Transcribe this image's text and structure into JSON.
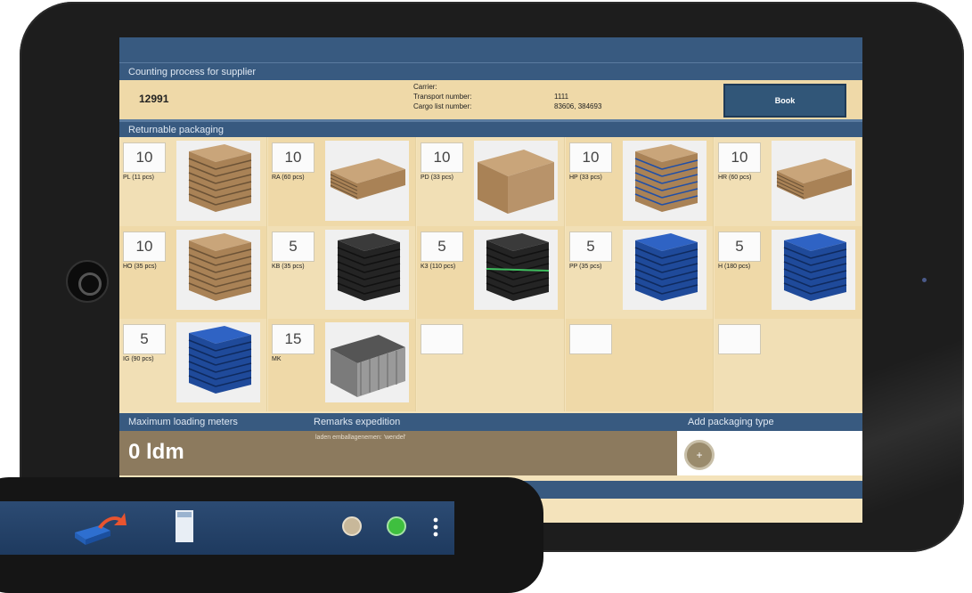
{
  "app": {
    "section_title": "Counting process for supplier",
    "supplier_id": "12991",
    "carrier_label": "Carrier:",
    "transport_label": "Transport number:",
    "cargo_label": "Cargo list number:",
    "transport_value": "1111",
    "cargo_value": "83606, 384693",
    "book_label": "Book",
    "packaging_title": "Returnable packaging"
  },
  "packaging": [
    {
      "count": "10",
      "label": "PL (11 pcs)",
      "kind": "wood"
    },
    {
      "count": "10",
      "label": "RA (60 pcs)",
      "kind": "wood-flat"
    },
    {
      "count": "10",
      "label": "PD (33 pcs)",
      "kind": "wood-box"
    },
    {
      "count": "10",
      "label": "HP (33 pcs)",
      "kind": "wood-blue"
    },
    {
      "count": "10",
      "label": "HR (60 pcs)",
      "kind": "wood-flat"
    },
    {
      "count": "10",
      "label": "HO (35 pcs)",
      "kind": "wood"
    },
    {
      "count": "5",
      "label": "KB (35 pcs)",
      "kind": "dark"
    },
    {
      "count": "5",
      "label": "K3 (110 pcs)",
      "kind": "dark-green"
    },
    {
      "count": "5",
      "label": "PP (35 pcs)",
      "kind": "blue"
    },
    {
      "count": "5",
      "label": "H (180 pcs)",
      "kind": "blue"
    },
    {
      "count": "5",
      "label": "IG (90 pcs)",
      "kind": "blue"
    },
    {
      "count": "15",
      "label": "MK",
      "kind": "metal"
    },
    {
      "count": "",
      "label": "",
      "kind": "none"
    },
    {
      "count": "",
      "label": "",
      "kind": "none"
    },
    {
      "count": "",
      "label": "",
      "kind": "none"
    }
  ],
  "bottom": {
    "max_loading_label": "Maximum loading meters",
    "remarks_label": "Remarks expedition",
    "add_packaging_label": "Add packaging type",
    "ldm_value": "0 ldm",
    "remarks_text": "laden emballagenemen: 'wendel'"
  },
  "colors": {
    "header_blue": "#385a80",
    "panel_beige": "#f4e3bb",
    "ldm_brown": "#8c7a5e"
  },
  "icons": [
    "truck-icon",
    "document-icon",
    "circle-button-icon",
    "green-refresh-icon",
    "more-vertical-icon",
    "home-button-icon",
    "add-icon"
  ]
}
